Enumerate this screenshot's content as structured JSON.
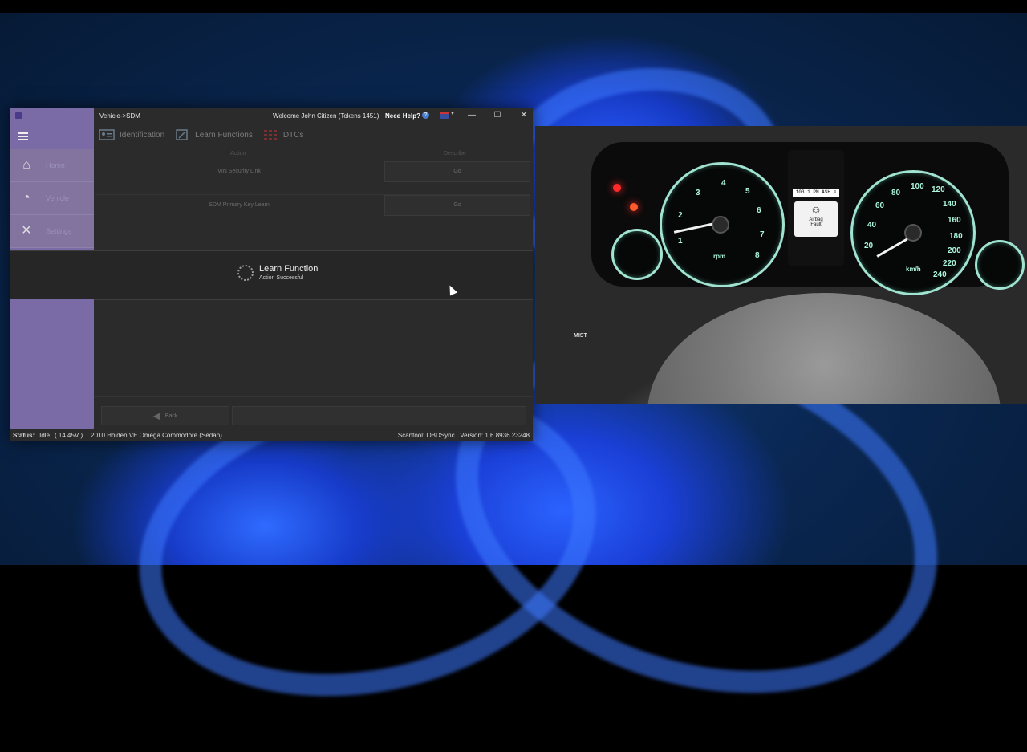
{
  "window": {
    "breadcrumb": "Vehicle->SDM",
    "welcome": "Welcome John Citizen (Tokens 1451)",
    "help_label": "Need Help?",
    "help_icon": "?",
    "minimize": "—",
    "maximize": "☐",
    "close": "✕"
  },
  "sidebar": {
    "items": [
      {
        "label": "Home",
        "icon": "home-icon"
      },
      {
        "label": "Vehicle",
        "icon": "gauge-icon"
      },
      {
        "label": "Settings",
        "icon": "tools-icon"
      }
    ]
  },
  "tabs": [
    {
      "label": "Identification",
      "icon": "id-card-icon"
    },
    {
      "label": "Learn Functions",
      "icon": "pencil-icon"
    },
    {
      "label": "DTCs",
      "icon": "grid-icon"
    }
  ],
  "grid": {
    "headers": {
      "action": "Action",
      "description": "Describe"
    },
    "rows": [
      {
        "action": "VIN Security Link",
        "go": "Go"
      },
      {
        "action": "SDM Primary Key Learn",
        "go": "Go"
      }
    ]
  },
  "overlay": {
    "title": "Learn Function",
    "subtitle": "Action Successful"
  },
  "footer": {
    "back_label": "Back"
  },
  "status": {
    "label": "Status:",
    "state": "Idle",
    "voltage": "( 14.45V )",
    "vehicle": "2010 Holden VE Omega Commodore (Sedan)",
    "scantool": "Scantool: OBDSync",
    "version": "Version: 1.6.8936.23248"
  },
  "dashboard": {
    "odometer": "103.1 PM ASH ≡",
    "airbag_line1": "Airbag",
    "airbag_line2": "Fault",
    "tach_numbers": [
      "1",
      "2",
      "3",
      "4",
      "5",
      "6",
      "7",
      "8"
    ],
    "tach_unit": "rpm",
    "speed_numbers": [
      "20",
      "40",
      "60",
      "80",
      "100",
      "120",
      "140",
      "160",
      "180",
      "200",
      "220",
      "240"
    ],
    "speed_unit": "km/h",
    "mist_label": "MIST"
  },
  "colors": {
    "sidebar": "#7a6ba6",
    "window_bg": "#2b2b2b",
    "gauge": "#9fe3d0",
    "warning": "#ff2a2a"
  }
}
